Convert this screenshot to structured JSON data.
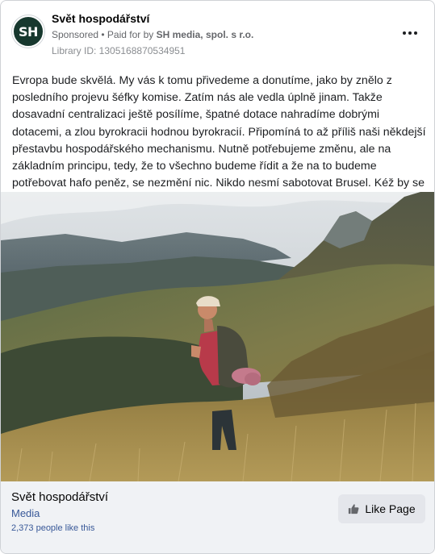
{
  "post": {
    "page_name": "Svět hospodářství",
    "avatar_initials": "SH",
    "sponsored_label": "Sponsored",
    "separator": " • ",
    "paid_for_prefix": "Paid for by ",
    "paid_for_by": "SH media, spol. s r.o.",
    "library_id": "Library ID: 1305168870534951",
    "more_icon": "more-horizontal-icon",
    "body_text": "Evropa bude skvělá. My vás k tomu přivedeme a donutíme, jako by znělo z posledního projevu šéfky komise. Zatím nás ale vedla úplně jinam. Takže dosavadní centralizaci ještě posílíme, špatné dotace nahradíme dobrými dotacemi, a zlou byrokracii hodnou byrokracií. Připomíná to až příliš naši někdejší přestavbu hospodářského mechanismu. Nutně potřebujeme změnu, ale na základním principu, tedy, že to všechno budeme řídit a že na to budeme potřebovat hafo peněz, se nezmění nic. Nikdo nesmí sabotovat Brusel. Kéž by se aspoň ta…"
  },
  "footer": {
    "page_name": "Svět hospodářství",
    "category": "Media",
    "likes": "2,373 people like this",
    "like_button_label": "Like Page",
    "like_icon": "thumbs-up-icon"
  },
  "colors": {
    "avatar_bg": "#17382e",
    "link_blue": "#385898",
    "footer_bg": "#f0f2f5",
    "button_bg": "#e4e6eb"
  }
}
